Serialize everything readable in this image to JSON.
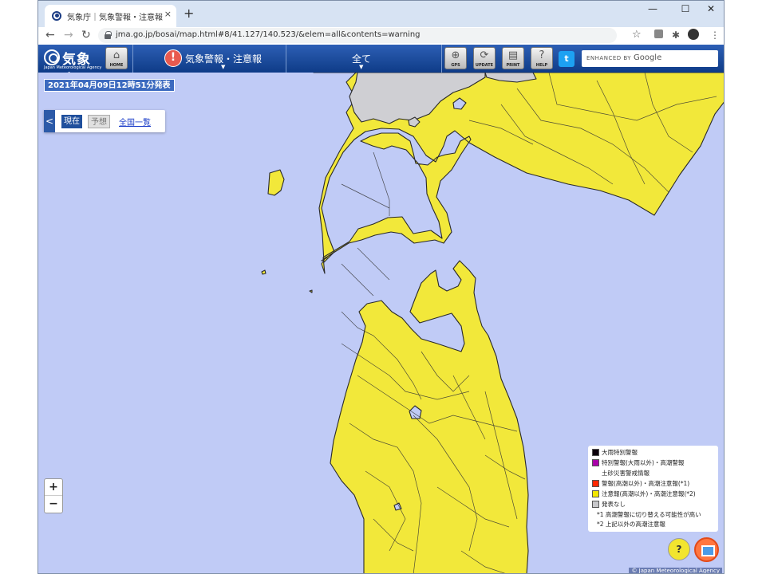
{
  "browser": {
    "tab_title": "気象庁｜気象警報・注意報",
    "tab_close": "×",
    "new_tab": "+",
    "minimize": "—",
    "maximize": "☐",
    "close": "✕",
    "back": "←",
    "forward": "→",
    "reload": "↻",
    "url": "jma.go.jp/bosai/map.html#8/41.127/140.523/&elem=all&contents=warning",
    "bookmark": "☆",
    "extensions": "✱",
    "menu": "⋮"
  },
  "header": {
    "logo_text": "気象庁",
    "logo_sub": "Japan Meteorological Agency",
    "home_label": "HOME",
    "warnings_menu": "気象警報・注意報",
    "filter_menu": "全て",
    "gps_label": "GPS",
    "update_label": "UPDATE",
    "print_label": "PRINT",
    "help_label": "HELP",
    "twitter": "t",
    "search_enhanced": "ENHANCED BY",
    "search_google": "Google"
  },
  "map": {
    "issued": "2021年04月09日12時51分発表",
    "mode_back": "<",
    "mode_now": "現在",
    "mode_forecast": "予想",
    "mode_all": "全国一覧",
    "zoom_in": "+",
    "zoom_out": "−",
    "legend": [
      {
        "label": "大雨特別警報",
        "color": "#0c000c"
      },
      {
        "label": "特別警報(大雨以外)・高潮警報",
        "color": "#aa00aa"
      },
      {
        "label": "土砂災害警戒情報",
        "color": ""
      },
      {
        "label": "警報(高潮以外)・高潮注意報(*1)",
        "color": "#ff2800"
      },
      {
        "label": "注意報(高潮以外)・高潮注意報(*2)",
        "color": "#f2e700"
      },
      {
        "label": "発表なし",
        "color": "#c8c8cb"
      }
    ],
    "notes": [
      "*1 高潮警報に切り替える可能性が高い",
      "*2 上記以外の高潮注意報"
    ],
    "copyright": "© Japan Meteorological Agency"
  }
}
